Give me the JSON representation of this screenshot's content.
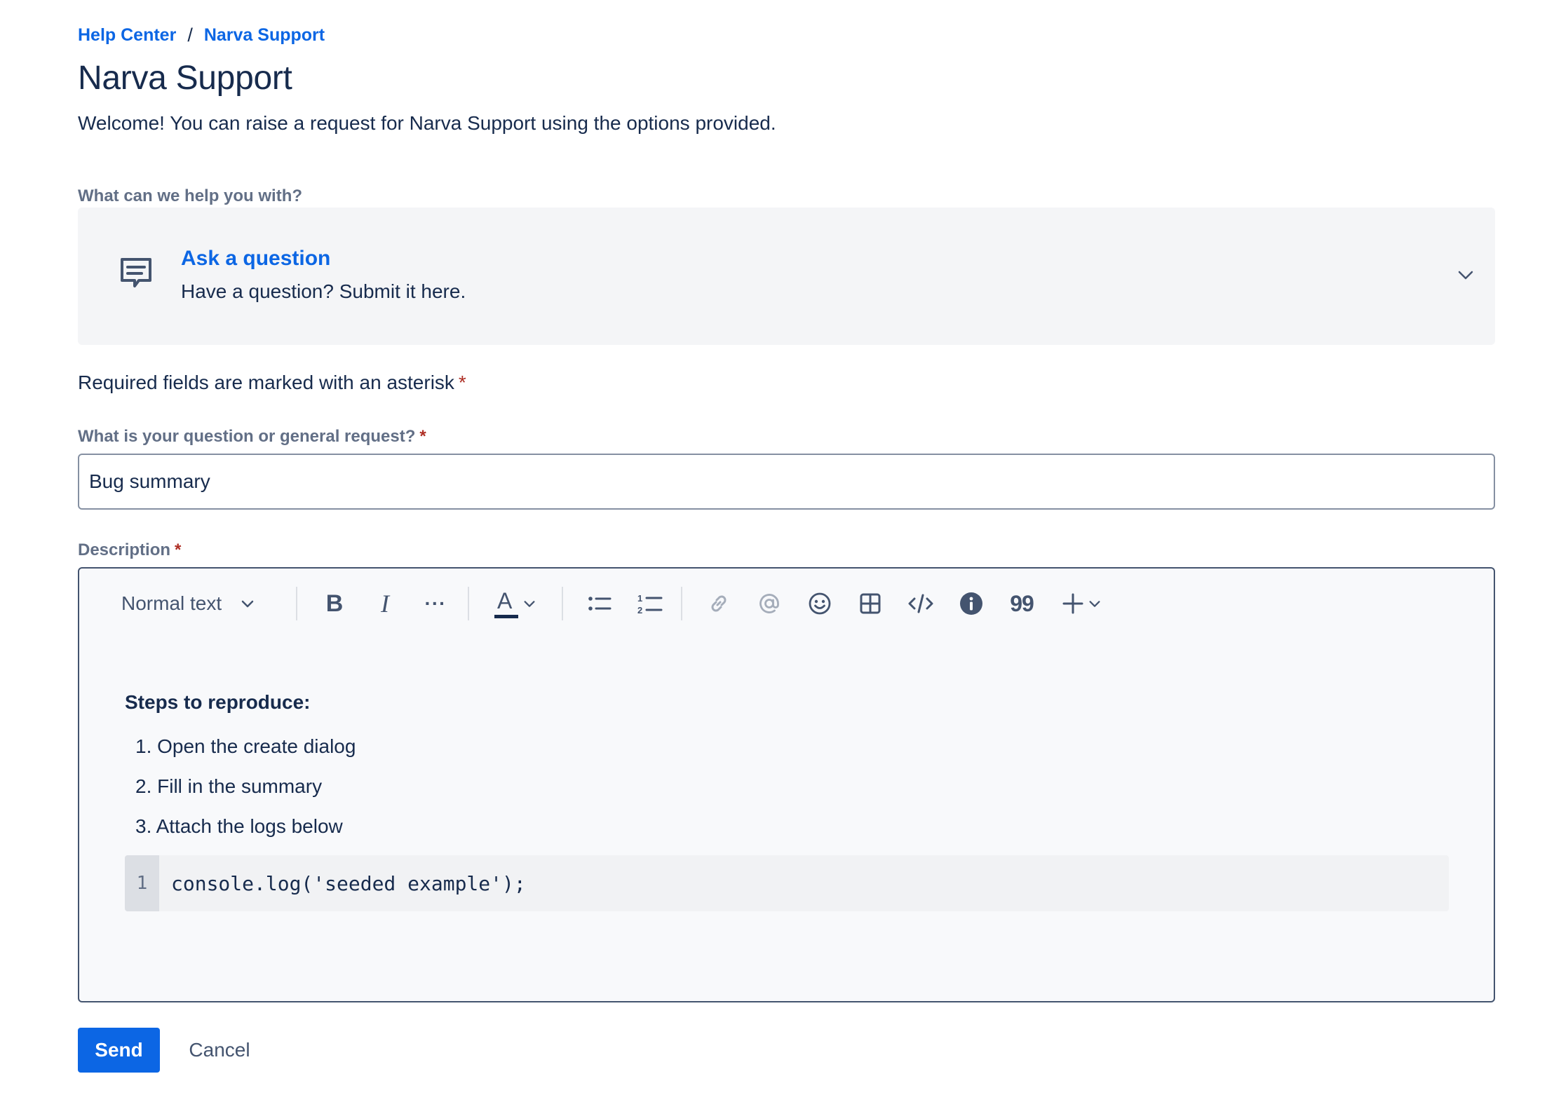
{
  "breadcrumb": {
    "items": [
      {
        "label": "Help Center"
      },
      {
        "label": "Narva Support"
      }
    ],
    "separator": "/"
  },
  "page": {
    "title": "Narva Support",
    "welcome": "Welcome! You can raise a request for Narva Support using the options provided."
  },
  "request_type": {
    "label": "What can we help you with?",
    "icon": "comment-icon",
    "selected_title": "Ask a question",
    "selected_description": "Have a question? Submit it here."
  },
  "form": {
    "required_note": "Required fields are marked with an asterisk",
    "required_marker": "*",
    "summary": {
      "label": "What is your question or general request?",
      "value": "Bug summary"
    },
    "description": {
      "label": "Description"
    }
  },
  "editor": {
    "toolbar": {
      "text_style": "Normal text",
      "icons": [
        "bold-icon",
        "italic-icon",
        "more-formatting-icon",
        "text-color-icon",
        "bullet-list-icon",
        "numbered-list-icon",
        "link-icon",
        "mention-icon",
        "emoji-icon",
        "table-icon",
        "code-icon",
        "info-panel-icon",
        "quote-icon",
        "insert-more-icon"
      ],
      "bold_glyph": "B",
      "italic_glyph": "I",
      "more_glyph": "···",
      "text_color_glyph": "A",
      "quote_glyph": "99"
    },
    "content": {
      "heading": "Steps to reproduce:",
      "steps": [
        "1. Open the create dialog",
        "2. Fill in the summary",
        "3. Attach the logs below"
      ],
      "code": {
        "line_number": "1",
        "line": "console.log('seeded example');"
      }
    }
  },
  "actions": {
    "send": "Send",
    "cancel": "Cancel"
  },
  "colors": {
    "link": "#0c66e4",
    "text": "#172b4d",
    "required": "#ae2e24",
    "primary_button": "#0c66e4"
  }
}
